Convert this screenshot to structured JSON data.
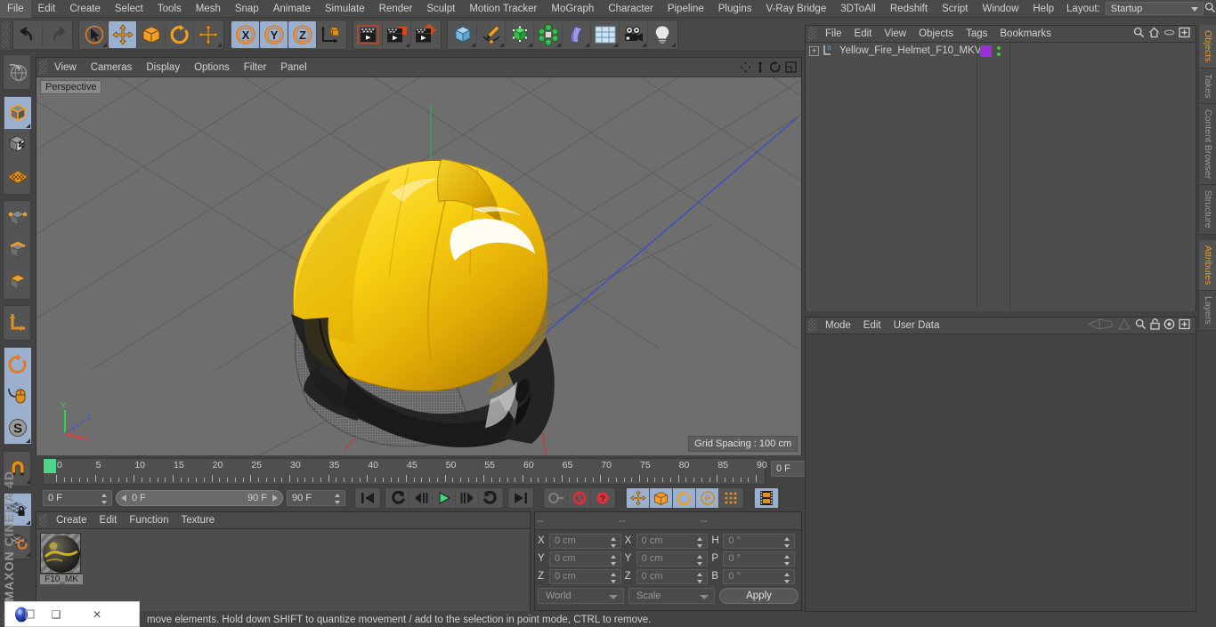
{
  "app": {
    "name": "Cinema 4D",
    "brand_top": "MAXON",
    "brand_bottom": "CINEMA 4D"
  },
  "menubar": {
    "items": [
      "File",
      "Edit",
      "Create",
      "Select",
      "Tools",
      "Mesh",
      "Snap",
      "Animate",
      "Simulate",
      "Render",
      "Sculpt",
      "Motion Tracker",
      "MoGraph",
      "Character",
      "Pipeline",
      "Plugins",
      "V-Ray Bridge",
      "3DToAll",
      "Redshift",
      "Script",
      "Window",
      "Help"
    ],
    "layout_label": "Layout:",
    "layout_value": "Startup",
    "search_icon": "search-icon"
  },
  "toolbar": {
    "groups": [
      {
        "name": "history",
        "buttons": [
          {
            "name": "undo",
            "icon": "undo-arrow-icon",
            "state": "normal"
          },
          {
            "name": "redo",
            "icon": "redo-arrow-icon",
            "state": "disabled"
          }
        ]
      },
      {
        "name": "tools",
        "buttons": [
          {
            "name": "live-selection",
            "icon": "cursor-circle-icon",
            "state": "normal"
          },
          {
            "name": "move",
            "icon": "move-arrows-icon",
            "state": "active"
          },
          {
            "name": "scale",
            "icon": "scale-box-icon",
            "state": "normal"
          },
          {
            "name": "rotate",
            "icon": "rotate-circle-icon",
            "state": "normal"
          },
          {
            "name": "transform",
            "icon": "move-arrows-icon",
            "state": "normal"
          }
        ]
      },
      {
        "name": "axis-lock",
        "buttons": [
          {
            "name": "lock-x",
            "icon": "axis-x-icon",
            "state": "active",
            "label": "X"
          },
          {
            "name": "lock-y",
            "icon": "axis-y-icon",
            "state": "active",
            "label": "Y"
          },
          {
            "name": "lock-z",
            "icon": "axis-z-icon",
            "state": "active",
            "label": "Z"
          },
          {
            "name": "world-object-coord",
            "icon": "world-axis-cube-icon",
            "state": "normal"
          }
        ]
      },
      {
        "name": "render",
        "buttons": [
          {
            "name": "render-view",
            "icon": "render-clapper-icon",
            "state": "normal"
          },
          {
            "name": "render-region",
            "icon": "render-region-icon",
            "state": "normal"
          },
          {
            "name": "render-settings",
            "icon": "render-settings-gear-icon",
            "state": "normal"
          }
        ]
      },
      {
        "name": "objects",
        "buttons": [
          {
            "name": "add-cube",
            "icon": "blue-cube-icon",
            "state": "normal"
          },
          {
            "name": "add-spline",
            "icon": "pen-spline-icon",
            "state": "normal"
          },
          {
            "name": "add-nurbs",
            "icon": "green-cube-nurbs-icon",
            "state": "normal"
          },
          {
            "name": "add-array",
            "icon": "green-cluster-icon",
            "state": "normal"
          },
          {
            "name": "add-deformer",
            "icon": "purple-bend-icon",
            "state": "normal"
          },
          {
            "name": "add-environment",
            "icon": "floor-grid-icon",
            "state": "normal"
          },
          {
            "name": "add-camera",
            "icon": "camera-icon",
            "state": "normal"
          },
          {
            "name": "add-light",
            "icon": "light-bulb-icon",
            "state": "normal"
          }
        ]
      }
    ]
  },
  "left_palette": {
    "groups": [
      {
        "name": "undo-view",
        "buttons": [
          {
            "name": "undo-view",
            "icon": "globe-grid-icon",
            "state": "normal"
          }
        ]
      },
      {
        "name": "modes",
        "buttons": [
          {
            "name": "model-mode",
            "icon": "orange-cube-icon",
            "state": "active"
          },
          {
            "name": "texture-mode",
            "icon": "checker-cube-icon",
            "state": "normal"
          },
          {
            "name": "uv-mode",
            "icon": "orange-grid-icon",
            "state": "normal"
          }
        ]
      },
      {
        "name": "components",
        "buttons": [
          {
            "name": "points-mode",
            "icon": "cube-points-icon",
            "state": "normal"
          },
          {
            "name": "edges-mode",
            "icon": "cube-edges-icon",
            "state": "normal"
          },
          {
            "name": "polygons-mode",
            "icon": "cube-polygons-icon",
            "state": "normal"
          }
        ]
      },
      {
        "name": "axis",
        "buttons": [
          {
            "name": "enable-axis",
            "icon": "orange-axis-icon",
            "state": "normal"
          }
        ]
      },
      {
        "name": "snapping",
        "buttons": [
          {
            "name": "viewport-solo",
            "icon": "circle-arrow-icon",
            "state": "active"
          },
          {
            "name": "mouse-tool",
            "icon": "mouse-icon",
            "state": "active"
          },
          {
            "name": "s-tool",
            "icon": "s-circle-icon",
            "state": "active"
          }
        ]
      },
      {
        "name": "magnet",
        "buttons": [
          {
            "name": "magnet-tool",
            "icon": "magnet-icon",
            "state": "normal"
          }
        ]
      },
      {
        "name": "grid",
        "buttons": [
          {
            "name": "lock-workplane",
            "icon": "grid-lock-icon",
            "state": "active"
          },
          {
            "name": "workplane-rotate",
            "icon": "grid-rotate-icon",
            "state": "normal"
          }
        ]
      }
    ]
  },
  "viewport": {
    "menu": [
      "View",
      "Cameras",
      "Display",
      "Options",
      "Filter",
      "Panel"
    ],
    "header_icons": [
      "pan-icon",
      "dolly-icon",
      "rotate-icon",
      "maximize-icon"
    ],
    "label": "Perspective",
    "grid_spacing": "Grid Spacing : 100 cm",
    "axis_gizmo": {
      "y": "Y",
      "z": "Z",
      "x": "X",
      "y_color": "#2fd64a",
      "z_color": "#3a55e8",
      "x_color": "#e63c3c"
    },
    "background": "#6e6e6e",
    "object_colors": {
      "helmet_yellow": "#f0c20a",
      "helmet_dark": "#2a2a2a",
      "highlight": "#ffffff"
    }
  },
  "timeline": {
    "ticks": [
      "0",
      "5",
      "10",
      "15",
      "20",
      "25",
      "30",
      "35",
      "40",
      "45",
      "50",
      "55",
      "60",
      "65",
      "70",
      "75",
      "80",
      "85",
      "90"
    ],
    "current_frame_field": "0 F",
    "start_field": "0 F",
    "range_min": "0 F",
    "range_max": "90 F",
    "end_field": "90 F",
    "playback": [
      {
        "name": "go-to-start",
        "icon": "skip-start-icon"
      },
      {
        "name": "previous-key",
        "icon": "prev-key-icon"
      },
      {
        "name": "step-back",
        "icon": "step-back-icon"
      },
      {
        "name": "play",
        "icon": "play-icon"
      },
      {
        "name": "step-forward",
        "icon": "step-forward-icon"
      },
      {
        "name": "next-key",
        "icon": "next-key-icon"
      },
      {
        "name": "go-to-end",
        "icon": "skip-end-icon"
      }
    ],
    "record": [
      {
        "name": "record-keyframe",
        "icon": "key-icon",
        "state": "disabled"
      },
      {
        "name": "autokeying",
        "icon": "red-circle-icon",
        "state": "normal"
      },
      {
        "name": "keyframe-selection",
        "icon": "red-question-icon",
        "state": "normal"
      }
    ],
    "record_params": [
      {
        "name": "record-position",
        "icon": "move-arrows-icon",
        "state": "active"
      },
      {
        "name": "record-scale",
        "icon": "scale-box-icon",
        "state": "active"
      },
      {
        "name": "record-rotation",
        "icon": "rotate-circle-icon",
        "state": "active"
      },
      {
        "name": "record-pla",
        "icon": "p-circle-icon",
        "state": "active"
      },
      {
        "name": "keyframe-dots",
        "icon": "dot-matrix-icon",
        "state": "normal"
      }
    ],
    "extra": [
      {
        "name": "timeline-toggle",
        "icon": "filmstrip-icon",
        "state": "active"
      }
    ]
  },
  "material_panel": {
    "menu": [
      "Create",
      "Edit",
      "Function",
      "Texture"
    ],
    "materials": [
      {
        "name": "F10_MK",
        "label": "F10_MK"
      }
    ]
  },
  "coordinates": {
    "header": [
      "--",
      "--",
      "--"
    ],
    "rows": [
      {
        "pos_label": "X",
        "pos_value": "0 cm",
        "size_label": "X",
        "size_value": "0 cm",
        "rot_label": "H",
        "rot_value": "0 °"
      },
      {
        "pos_label": "Y",
        "pos_value": "0 cm",
        "size_label": "Y",
        "size_value": "0 cm",
        "rot_label": "P",
        "rot_value": "0 °"
      },
      {
        "pos_label": "Z",
        "pos_value": "0 cm",
        "size_label": "Z",
        "size_value": "0 cm",
        "rot_label": "B",
        "rot_value": "0 °"
      }
    ],
    "coord_system": "World",
    "transform_mode": "Scale",
    "apply_label": "Apply"
  },
  "object_manager": {
    "menu": [
      "File",
      "Edit",
      "View",
      "Objects",
      "Tags",
      "Bookmarks"
    ],
    "header_icons": [
      "search-icon",
      "home-icon",
      "ellipse-icon",
      "fit-icon"
    ],
    "objects": [
      {
        "name": "Yellow_Fire_Helmet_F10_MKV",
        "layer": "0",
        "swatch_color": "#9b2fd6"
      }
    ]
  },
  "attribute_manager": {
    "menu": [
      "Mode",
      "Edit",
      "User Data"
    ],
    "header_icons": [
      "back-nav-icon",
      "forward-nav-icon",
      "search-icon",
      "lock-icon",
      "target-icon",
      "fit-icon"
    ]
  },
  "side_tabs": {
    "top": [
      {
        "label": "Objects",
        "selected": true
      },
      {
        "label": "Takes",
        "selected": false
      },
      {
        "label": "Content Browser",
        "selected": false
      },
      {
        "label": "Structure",
        "selected": false
      }
    ],
    "bottom": [
      {
        "label": "Attributes",
        "selected": true
      },
      {
        "label": "Layers",
        "selected": false
      }
    ]
  },
  "statusbar": {
    "message": "move elements. Hold down SHIFT to quantize movement / add to the selection in point mode, CTRL to remove."
  },
  "os_overlay": {
    "app_icon": "blue-orb-icon",
    "buttons": [
      {
        "name": "restore",
        "glyph": "❑"
      },
      {
        "name": "close",
        "glyph": "✕"
      }
    ]
  }
}
